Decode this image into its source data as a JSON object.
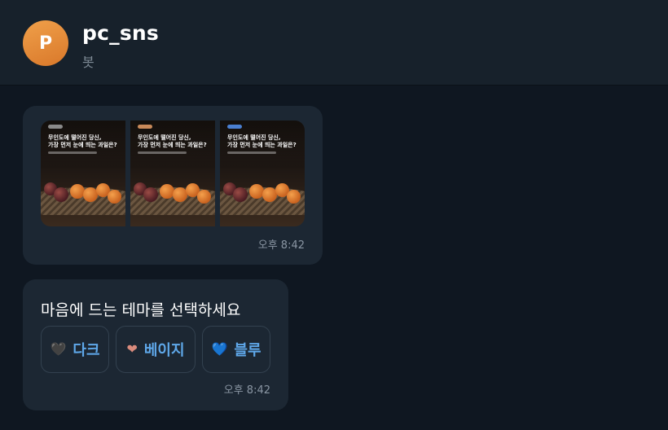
{
  "header": {
    "avatar_letter": "P",
    "title": "pc_sns",
    "subtitle": "봇",
    "avatar_color": "#e88a35"
  },
  "messages": [
    {
      "type": "gallery",
      "cards": [
        {
          "line1": "무인도에 떨어진 당신,",
          "line2": "가장 먼저 눈에 띄는 과일은?",
          "tag_color": "#8a8a8a"
        },
        {
          "line1": "무인도에 떨어진 당신,",
          "line2": "가장 먼저 눈에 띄는 과일은?",
          "tag_color": "#c98a5a"
        },
        {
          "line1": "무인도에 떨어진 당신,",
          "line2": "가장 먼저 눈에 띄는 과일은?",
          "tag_color": "#4a7fd0"
        }
      ],
      "time": "오후 8:42"
    },
    {
      "type": "choices",
      "prompt": "마음에 드는 테마를 선택하세요",
      "options": [
        {
          "icon": "black-heart-icon",
          "glyph": "🖤",
          "label": "다크",
          "color": "#3a2a44"
        },
        {
          "icon": "beige-heart-icon",
          "glyph": "❤",
          "label": "베이지",
          "color": "#d98b7d"
        },
        {
          "icon": "blue-heart-icon",
          "glyph": "💙",
          "label": "블루",
          "color": "#3b82f6"
        }
      ],
      "time": "오후 8:42"
    }
  ],
  "colors": {
    "background": "#0f1721",
    "header": "#17212b",
    "bubble": "#1c2733",
    "accent": "#5fa8ea"
  }
}
